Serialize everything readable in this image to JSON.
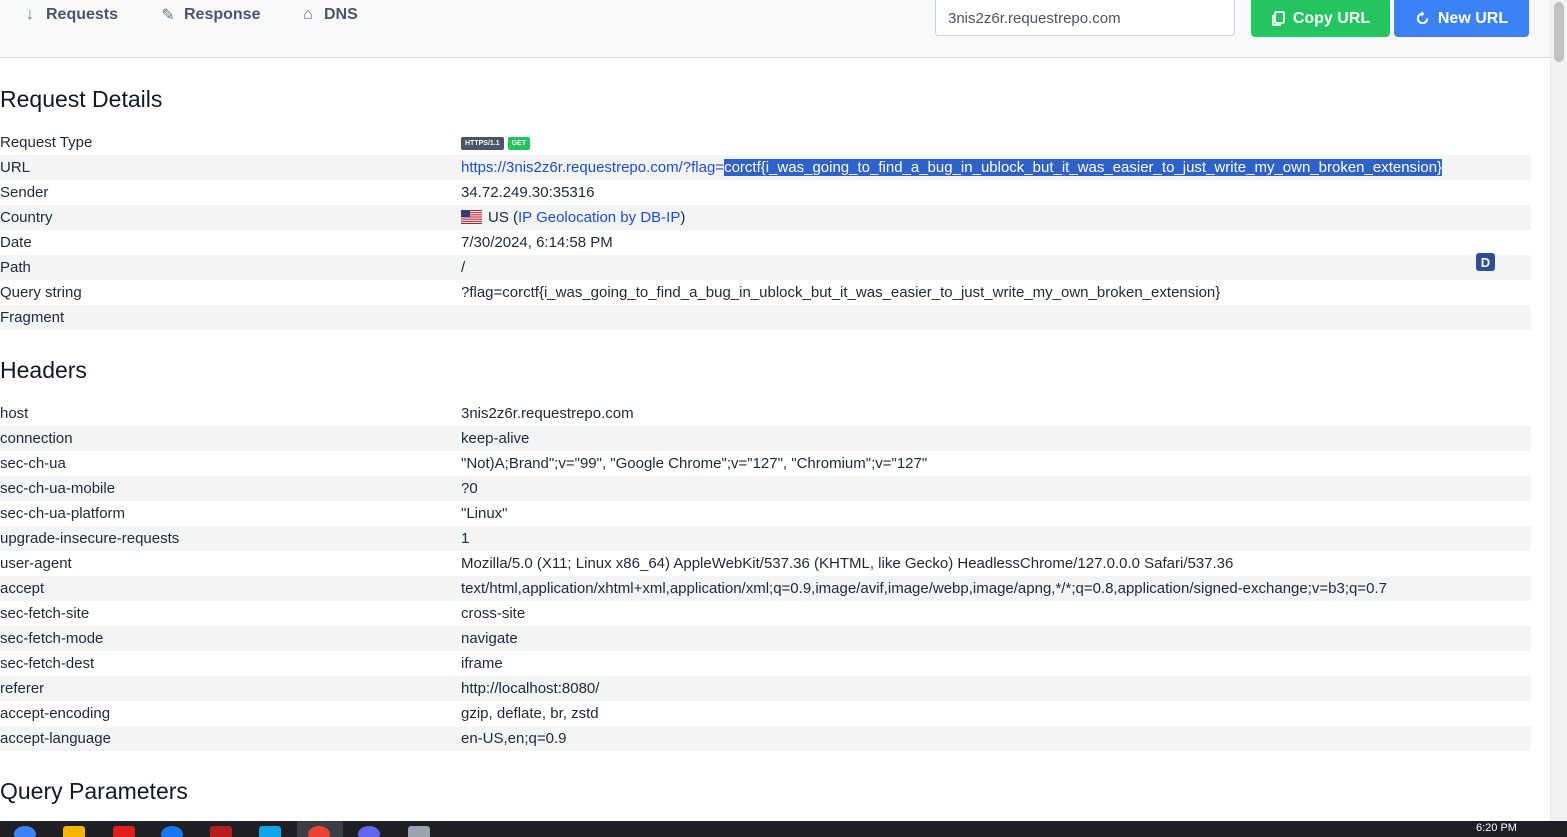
{
  "nav": {
    "tabs": [
      {
        "label": "Requests",
        "icon": "arrow-down-icon"
      },
      {
        "label": "Response",
        "icon": "pencil-icon"
      },
      {
        "label": "DNS",
        "icon": "home-icon"
      }
    ],
    "url_value": "3nis2z6r.requestrepo.com",
    "copy_label": "Copy URL",
    "new_label": "New URL"
  },
  "request_details": {
    "title": "Request Details",
    "request_type_label": "Request Type",
    "protocol_badge": "HTTPS/1.1",
    "method_badge": "GET",
    "url_label": "URL",
    "url_prefix": "https://3nis2z6r.requestrepo.com/?flag=",
    "url_selected": "corctf{i_was_going_to_find_a_bug_in_ublock_but_it_was_easier_to_just_write_my_own_broken_extension}",
    "sender_label": "Sender",
    "sender": "34.72.249.30:35316",
    "country_label": "Country",
    "country_code": "US",
    "country_open": " (",
    "geo_link": "IP Geolocation by DB-IP",
    "country_close": ")",
    "date_label": "Date",
    "date": "7/30/2024, 6:14:58 PM",
    "path_label": "Path",
    "path": "/",
    "query_label": "Query string",
    "query": "?flag=corctf{i_was_going_to_find_a_bug_in_ublock_but_it_was_easier_to_just_write_my_own_broken_extension}",
    "fragment_label": "Fragment",
    "fragment": ""
  },
  "headers": {
    "title": "Headers",
    "rows": [
      {
        "key": "host",
        "value": "3nis2z6r.requestrepo.com"
      },
      {
        "key": "connection",
        "value": "keep-alive"
      },
      {
        "key": "sec-ch-ua",
        "value": "\"Not)A;Brand\";v=\"99\", \"Google Chrome\";v=\"127\", \"Chromium\";v=\"127\""
      },
      {
        "key": "sec-ch-ua-mobile",
        "value": "?0"
      },
      {
        "key": "sec-ch-ua-platform",
        "value": "\"Linux\""
      },
      {
        "key": "upgrade-insecure-requests",
        "value": "1"
      },
      {
        "key": "user-agent",
        "value": "Mozilla/5.0 (X11; Linux x86_64) AppleWebKit/537.36 (KHTML, like Gecko) HeadlessChrome/127.0.0.0 Safari/537.36"
      },
      {
        "key": "accept",
        "value": "text/html,application/xhtml+xml,application/xml;q=0.9,image/avif,image/webp,image/apng,*/*;q=0.8,application/signed-exchange;v=b3;q=0.7"
      },
      {
        "key": "sec-fetch-site",
        "value": "cross-site"
      },
      {
        "key": "sec-fetch-mode",
        "value": "navigate"
      },
      {
        "key": "sec-fetch-dest",
        "value": "iframe"
      },
      {
        "key": "referer",
        "value": "http://localhost:8080/"
      },
      {
        "key": "accept-encoding",
        "value": "gzip, deflate, br, zstd"
      },
      {
        "key": "accept-language",
        "value": "en-US,en;q=0.9"
      }
    ]
  },
  "query_params": {
    "title": "Query Parameters"
  },
  "extension_badge": "D",
  "taskbar": {
    "time": "6:20 PM"
  }
}
